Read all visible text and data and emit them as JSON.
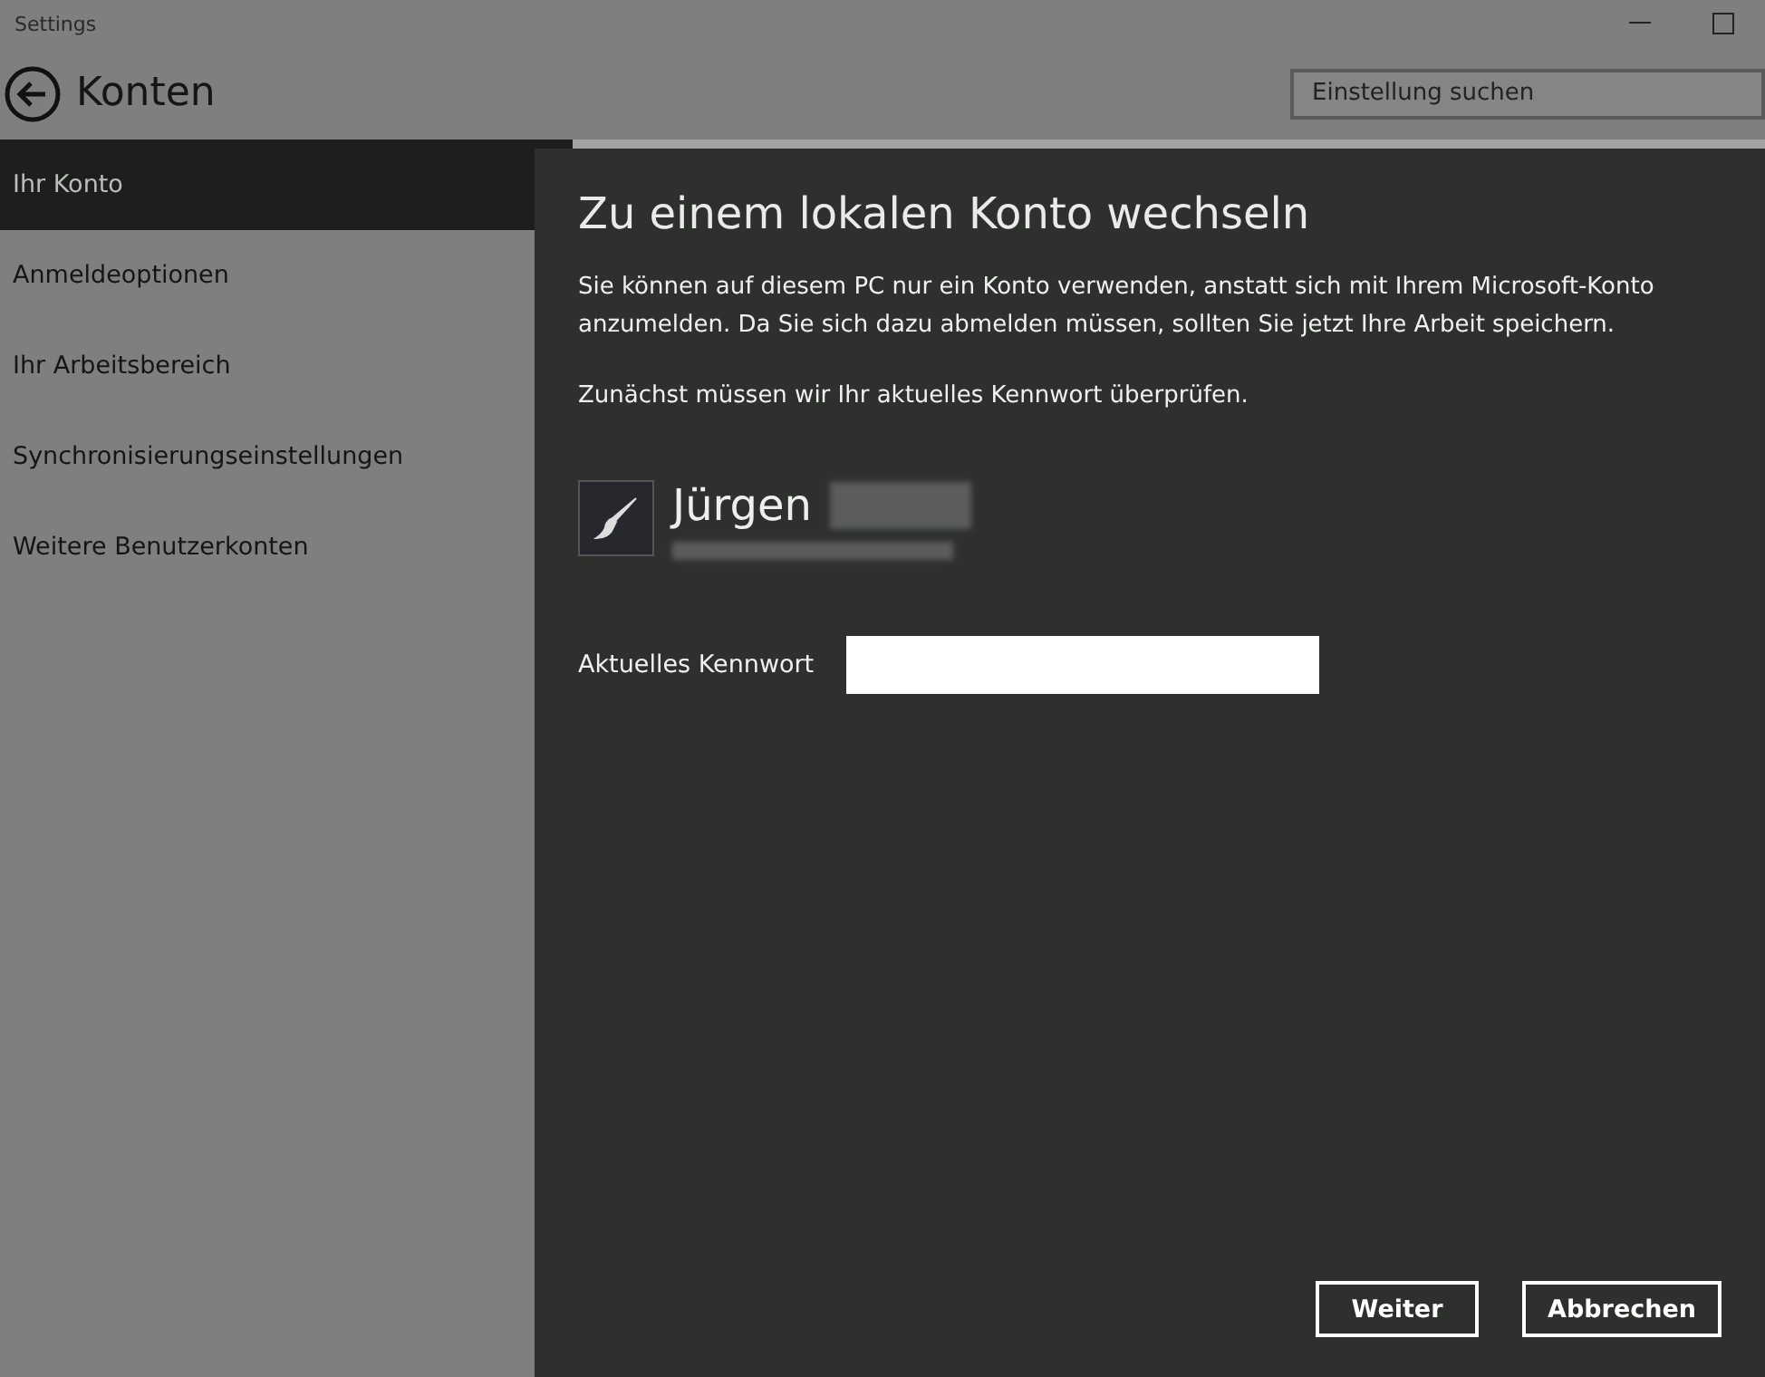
{
  "window": {
    "title": "Settings"
  },
  "header": {
    "title": "Konten",
    "search": {
      "placeholder": "Einstellung suchen"
    }
  },
  "sidebar": {
    "items": [
      {
        "label": "Ihr Konto",
        "selected": true
      },
      {
        "label": "Anmeldeoptionen",
        "selected": false
      },
      {
        "label": "Ihr Arbeitsbereich",
        "selected": false
      },
      {
        "label": "Synchronisierungseinstellungen",
        "selected": false
      },
      {
        "label": "Weitere Benutzerkonten",
        "selected": false
      }
    ]
  },
  "dialog": {
    "title": "Zu einem lokalen Konto wechseln",
    "paragraphs": [
      "Sie können auf diesem PC nur ein Konto verwenden, anstatt sich mit Ihrem Microsoft-Konto anzumelden. Da Sie sich dazu abmelden müssen, sollten Sie jetzt Ihre Arbeit speichern.",
      "Zunächst müssen wir Ihr aktuelles Kennwort überprüfen."
    ],
    "user": {
      "name": "Jürgen"
    },
    "password": {
      "label": "Aktuelles Kennwort"
    },
    "buttons": [
      "Weiter",
      "Abbrechen"
    ]
  }
}
